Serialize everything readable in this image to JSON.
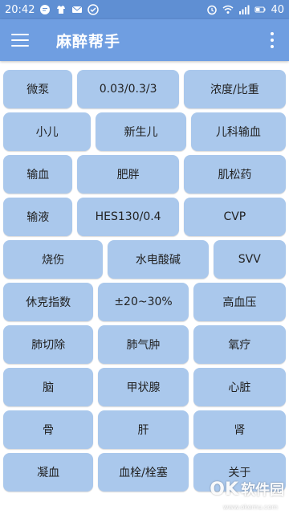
{
  "status_bar": {
    "time": "20:42",
    "battery": "40"
  },
  "app_bar": {
    "title": "麻醉帮手"
  },
  "grid": {
    "rows": [
      [
        "微泵",
        "0.03/0.3/3",
        "浓度/比重"
      ],
      [
        "小儿",
        "新生儿",
        "儿科输血"
      ],
      [
        "输血",
        "肥胖",
        "肌松药"
      ],
      [
        "输液",
        "HES130/0.4",
        "CVP"
      ],
      [
        "烧伤",
        "水电酸碱",
        "SVV"
      ],
      [
        "休克指数",
        "±20~30%",
        "高血压"
      ],
      [
        "肺切除",
        "肺气肿",
        "氧疗"
      ],
      [
        "脑",
        "甲状腺",
        "心脏"
      ],
      [
        "骨",
        "肝",
        "肾"
      ],
      [
        "凝血",
        "血栓/栓塞",
        "关于"
      ]
    ]
  },
  "watermark": {
    "brand": "OK",
    "name": "软件园",
    "url": "www.okemu.com"
  },
  "colors": {
    "status_bar": "#5f8fd3",
    "app_bar": "#6f9ee1",
    "button": "#aac8ec"
  }
}
